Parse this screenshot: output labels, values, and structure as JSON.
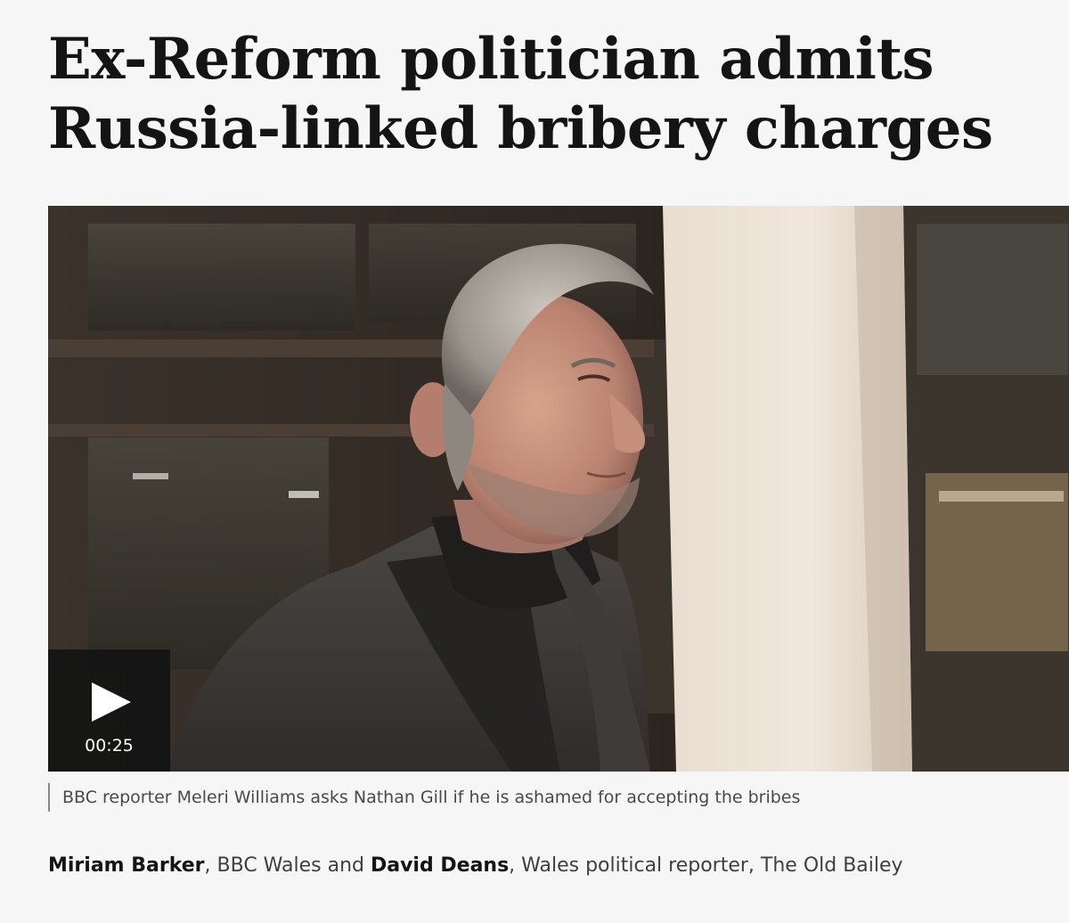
{
  "article": {
    "headline": "Ex-Reform politician admits Russia-linked bribery charges",
    "media": {
      "image_alt": "Grey-haired man in dark coat walking past office building",
      "duration": "00:25"
    },
    "caption": "BBC reporter Meleri Williams asks Nathan Gill if he is ashamed for accepting the bribes",
    "byline": {
      "author1": "Miriam Barker",
      "sep1": ", BBC Wales and ",
      "author2": "David Deans",
      "rest": ", Wales political reporter, The Old Bailey"
    }
  }
}
